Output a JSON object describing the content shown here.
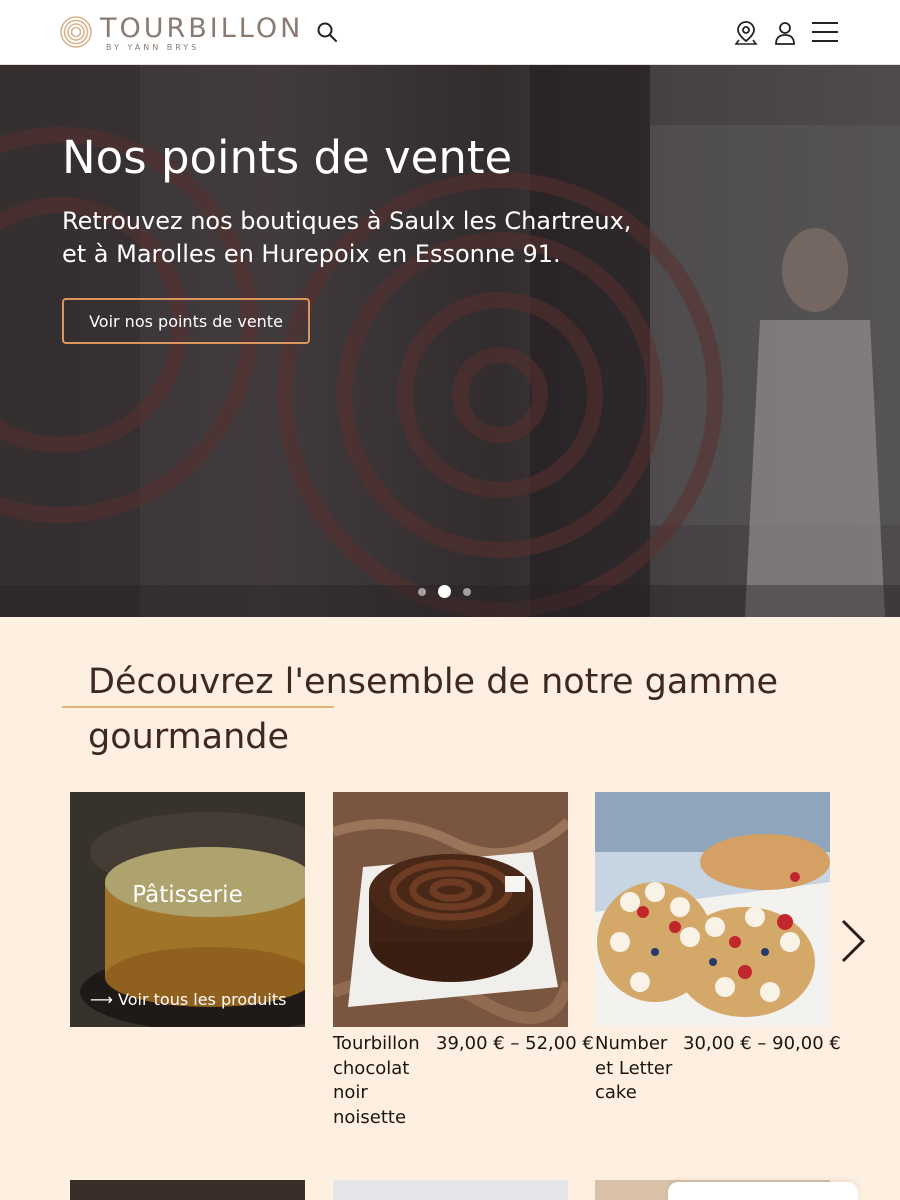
{
  "header": {
    "brand": "TOURBILLON",
    "brand_sub": "BY YANN BRYS",
    "icons": [
      "search-icon",
      "map-pin-icon",
      "user-icon",
      "menu-icon"
    ],
    "colors": {
      "brand": "#8a7b72",
      "accent": "#d9965e"
    }
  },
  "hero": {
    "title": "Nos points de vente",
    "text_line1": "Retrouvez nos boutiques à Saulx les Chartreux,",
    "text_line2": "et à Marolles en Hurepoix en Essonne 91.",
    "button_label": "Voir nos points de vente",
    "slides_count": 3,
    "active_slide": 2
  },
  "section": {
    "title": "Découvrez l'ensemble de notre gamme gourmande"
  },
  "category_card": {
    "label": "Pâtisserie",
    "link": "⟶ Voir tous les produits"
  },
  "products": [
    {
      "name": "Tourbillon chocolat noir noisette",
      "price": "39,00 € – 52,00 €"
    },
    {
      "name": "Number et Letter cake",
      "price": "30,00 € – 90,00 €"
    }
  ]
}
